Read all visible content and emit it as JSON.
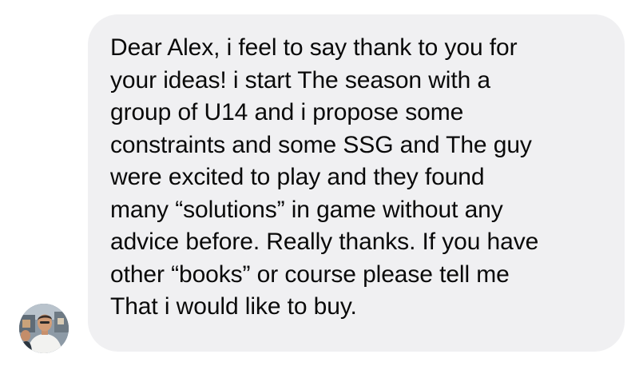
{
  "message": {
    "lines": [
      "Dear Alex, i feel to say thank to you for",
      "your ideas! i start The season with a",
      "group of U14 and i propose some",
      "constraints and some SSG and The guy",
      "were excited to play and they found",
      "many “solutions” in game without any",
      "advice before. Really thanks. If you have",
      "other “books” or course please tell me",
      "That i would like to buy."
    ]
  },
  "sender": {
    "avatar_icon": "user-avatar-photo"
  },
  "colors": {
    "bubble_background": "#f0f0f2",
    "text": "#0a0a0a",
    "page_background": "#ffffff"
  }
}
